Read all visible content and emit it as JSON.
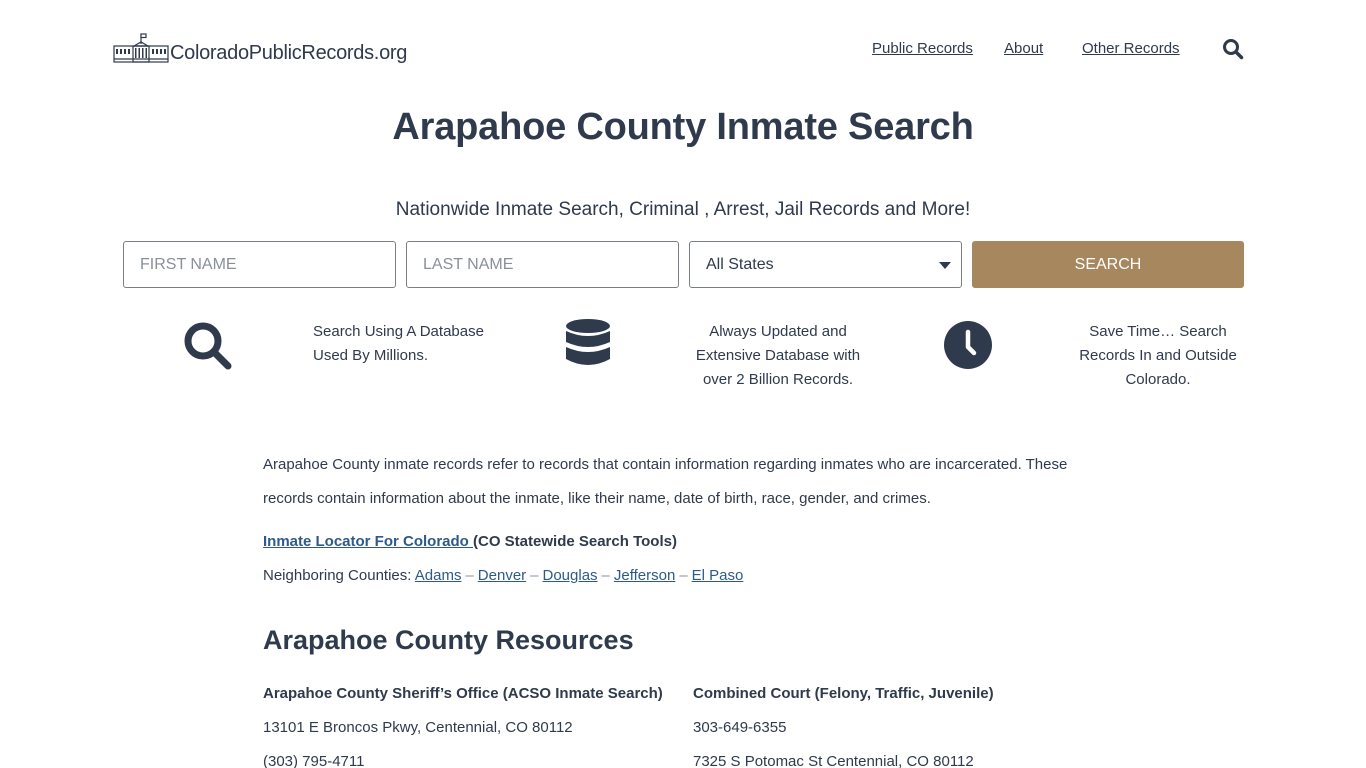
{
  "header": {
    "logo_text": "ColoradoPublicRecords.org",
    "nav": [
      {
        "label": "Public Records"
      },
      {
        "label": "About"
      },
      {
        "label": "Other Records"
      }
    ],
    "search_icon": "search-icon"
  },
  "hero": {
    "title": "Arapahoe County Inmate Search",
    "tagline": "Nationwide Inmate Search, Criminal , Arrest, Jail Records and More!"
  },
  "search_form": {
    "first_name_placeholder": "FIRST NAME",
    "first_name_value": "",
    "last_name_placeholder": "LAST NAME",
    "last_name_value": "",
    "state_selected": "All States",
    "search_label": "SEARCH",
    "button_color": "#a6875e"
  },
  "features": [
    {
      "icon": "search-icon",
      "text_lines": [
        "Search Using A Database",
        "Used By Millions."
      ]
    },
    {
      "icon": "database-icon",
      "text_lines": [
        "Always Updated and",
        "Extensive Database with",
        "over 2 Billion Records."
      ]
    },
    {
      "icon": "clock-icon",
      "text_lines": [
        "Save Time… Search",
        "Records In and Outside",
        "Colorado."
      ]
    }
  ],
  "content": {
    "intro": "Arapahoe County inmate records refer to records that contain information regarding inmates who are incarcerated. These records contain information about the inmate, like their name, date of birth, race, gender, and crimes.",
    "locator_link": "Inmate Locator For Colorado ",
    "locator_suffix": "(CO Statewide Search Tools)",
    "neighbors_label": "Neighboring Counties: ",
    "neighbors": [
      "Adams",
      "Denver",
      "Douglas",
      "Jefferson",
      "El Paso"
    ],
    "separator": "–",
    "resources_title": "Arapahoe County Resources",
    "resources": [
      {
        "name": "Arapahoe County Sheriff’s Office (ACSO Inmate Search)",
        "lines": [
          "13101 E Broncos Pkwy, Centennial, CO 80112",
          "(303) 795-4711"
        ]
      },
      {
        "name": "Combined Court (Felony, Traffic, Juvenile)",
        "lines": [
          "303-649-6355",
          "7325 S Potomac St Centennial, CO 80112"
        ]
      }
    ]
  },
  "colors": {
    "text": "#2f3a4c",
    "link": "#2e5a8a",
    "accent": "#a6875e"
  }
}
